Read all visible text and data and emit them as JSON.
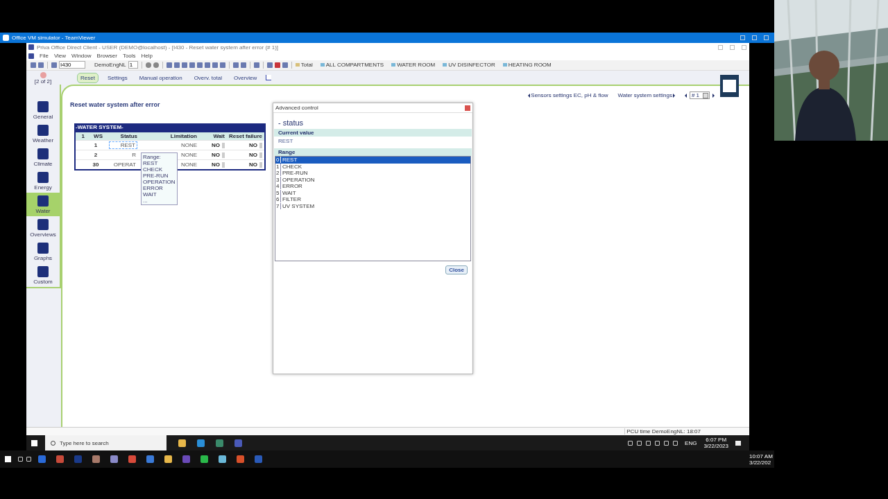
{
  "teamviewer": {
    "title": "Office VM simulator - TeamViewer"
  },
  "app": {
    "title": "Priva Office Direct Client - USER (DEMO@localhost) - [I430 - Reset water system after error (# 1)]",
    "menu": [
      "File",
      "View",
      "Window",
      "Browser",
      "Tools",
      "Help"
    ],
    "toolbar": {
      "page_field": "I430",
      "controller_label": "DemoEngNL",
      "controller_field": "1",
      "compartments": [
        "Total",
        "ALL COMPARTMENTS",
        "WATER ROOM",
        "UV DISINFECTOR",
        "HEATING ROOM"
      ]
    },
    "page_counter": "[2 of 2]",
    "tabs": [
      {
        "label": "Reset",
        "selected": true
      },
      {
        "label": "Settings",
        "selected": false
      },
      {
        "label": "Manual operation",
        "selected": false
      },
      {
        "label": "Overv. total",
        "selected": false
      },
      {
        "label": "Overview",
        "selected": false
      }
    ],
    "nav": [
      {
        "label": "General",
        "selected": false
      },
      {
        "label": "Weather",
        "selected": false
      },
      {
        "label": "Climate",
        "selected": false
      },
      {
        "label": "Energy",
        "selected": false
      },
      {
        "label": "Water",
        "selected": true
      },
      {
        "label": "Overviews",
        "selected": false
      },
      {
        "label": "Graphs",
        "selected": false
      },
      {
        "label": "Custom",
        "selected": false
      }
    ],
    "breadcrumbs": {
      "previous": "Sensors settings EC, pH & flow",
      "next": "Water system settings",
      "instance": "# 1"
    },
    "page_title": "Reset water system after error",
    "table": {
      "title": "-WATER SYSTEM-",
      "columns": [
        "1",
        "WS",
        "Status",
        "Limitation",
        "Wait",
        "Reset failure"
      ],
      "rows": [
        {
          "ws": "1",
          "status": "REST",
          "limitation": "NONE",
          "wait": "NO",
          "reset_failure": "NO",
          "selected": true
        },
        {
          "ws": "2",
          "status": "R",
          "limitation": "NONE",
          "wait": "NO",
          "reset_failure": "NO",
          "selected": false
        },
        {
          "ws": "30",
          "status": "OPERAT",
          "limitation": "NONE",
          "wait": "NO",
          "reset_failure": "NO",
          "selected": false
        }
      ]
    },
    "tooltip": {
      "title": "Range:",
      "lines": [
        "REST",
        "CHECK",
        "PRE-RUN",
        "OPERATION",
        "ERROR",
        "WAIT",
        "..."
      ]
    },
    "dialog": {
      "title": "Advanced control",
      "heading": "- status",
      "current_label": "Current value",
      "current_value": "REST",
      "range_label": "Range",
      "options": [
        {
          "index": "0",
          "label": "REST",
          "selected": true
        },
        {
          "index": "1",
          "label": "CHECK",
          "selected": false
        },
        {
          "index": "2",
          "label": "PRE-RUN",
          "selected": false
        },
        {
          "index": "3",
          "label": "OPERATION",
          "selected": false
        },
        {
          "index": "4",
          "label": "ERROR",
          "selected": false
        },
        {
          "index": "5",
          "label": "WAIT",
          "selected": false
        },
        {
          "index": "6",
          "label": "FILTER",
          "selected": false
        },
        {
          "index": "7",
          "label": "UV SYSTEM",
          "selected": false
        }
      ],
      "close": "Close"
    },
    "status_bar": "PCU time DemoEngNL: 18:07"
  },
  "remote_taskbar": {
    "search_placeholder": "Type here to search",
    "language": "ENG",
    "time": "6:07 PM",
    "date": "3/22/2023"
  },
  "local_taskbar": {
    "time": "10:07 AM",
    "date": "3/22/202"
  }
}
